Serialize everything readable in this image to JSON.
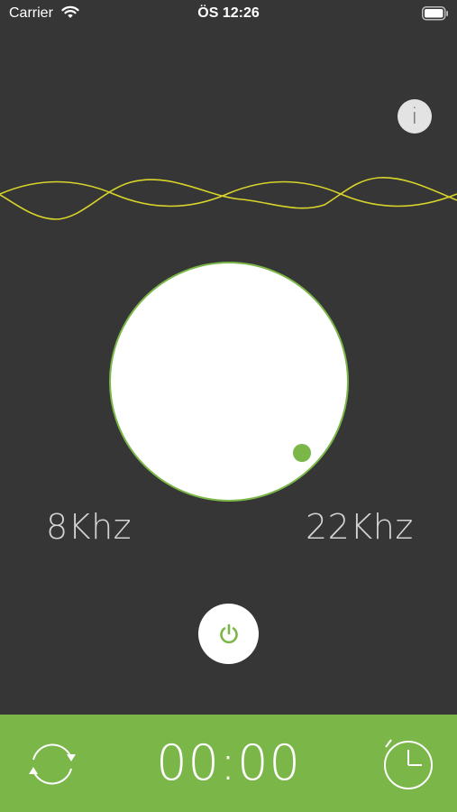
{
  "status_bar": {
    "carrier": "Carrier",
    "time": "ÖS 12:26"
  },
  "info_button": {
    "label": "i",
    "icon": "info-icon"
  },
  "dial": {
    "min_label": "8Khz",
    "max_label": "22Khz"
  },
  "power_button": {
    "icon": "power-icon"
  },
  "bottom_bar": {
    "repeat_icon": "repeat-icon",
    "timer_value": "00:00",
    "timer_icon": "timer-icon"
  },
  "colors": {
    "background": "#363636",
    "accent": "#7ab648",
    "wave": "#d8d42a"
  }
}
